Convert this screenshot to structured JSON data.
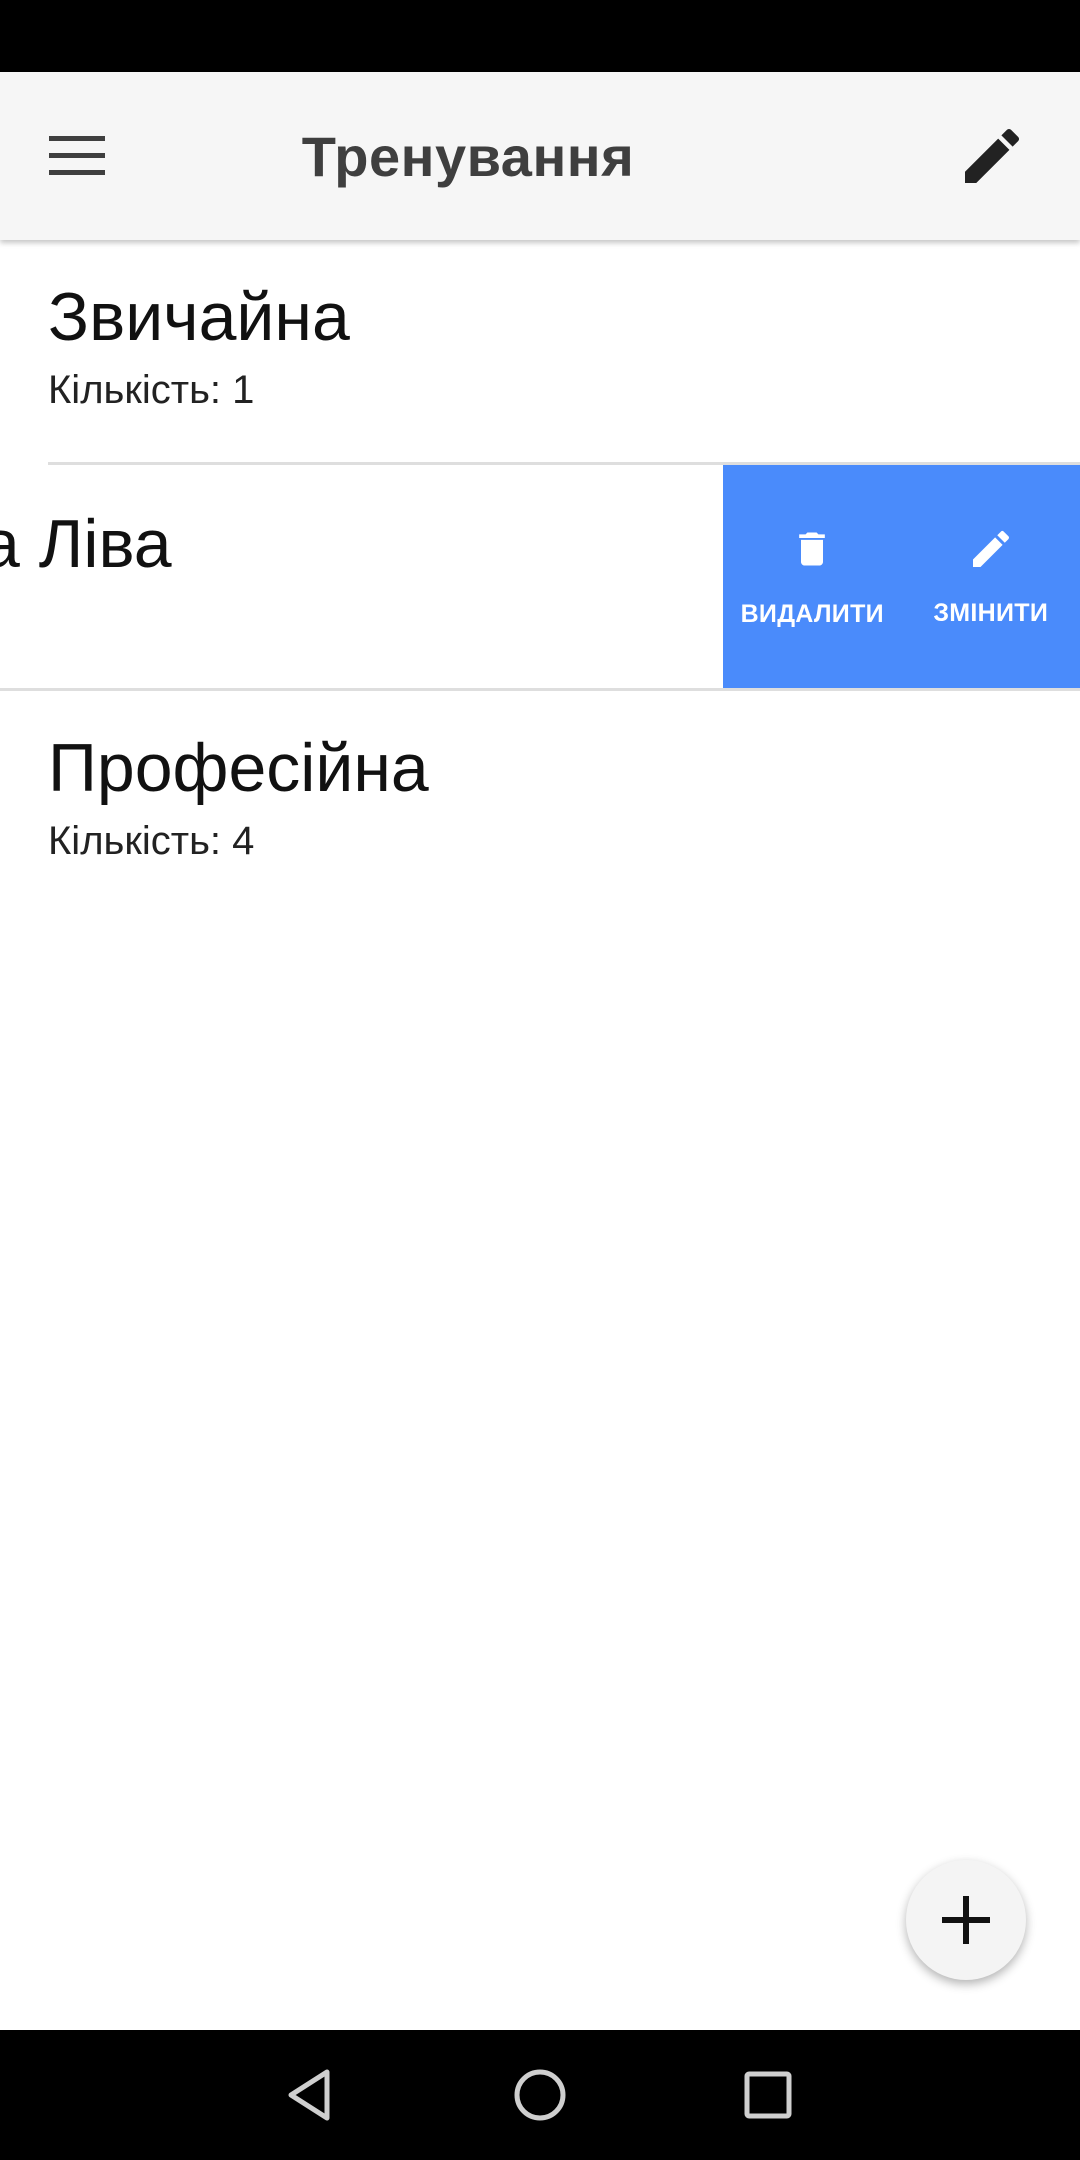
{
  "app_bar": {
    "title": "Тренування",
    "menu_icon": "hamburger-menu-icon",
    "edit_icon": "pencil-icon"
  },
  "workouts": [
    {
      "title": "Звичайна",
      "count_label": "Кількість: 1"
    },
    {
      "title": "а Ліва",
      "count_label": ""
    },
    {
      "title": "Професійна",
      "count_label": "Кількість: 4"
    }
  ],
  "swipe_actions": {
    "delete_label": "ВИДАЛИТИ",
    "delete_icon": "trash-icon",
    "edit_label": "ЗМІНИТИ",
    "edit_icon": "pencil-icon",
    "background_color": "#4a8bfb"
  },
  "fab": {
    "icon": "plus-icon"
  },
  "nav_bar": {
    "back_icon": "back-triangle-icon",
    "home_icon": "home-circle-icon",
    "recents_icon": "recents-square-icon"
  }
}
